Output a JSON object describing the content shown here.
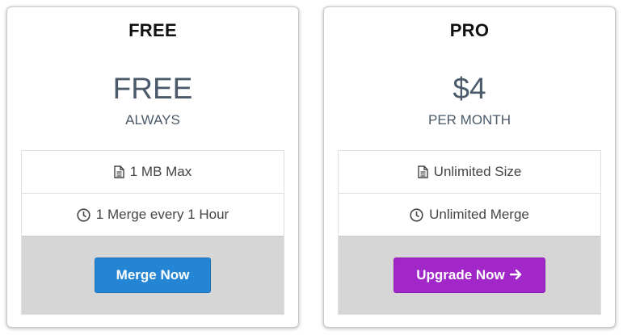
{
  "plans": [
    {
      "name": "FREE",
      "price": "FREE",
      "period": "ALWAYS",
      "features": [
        {
          "icon": "document-icon",
          "text": "1 MB Max"
        },
        {
          "icon": "clock-icon",
          "text": "1 Merge every 1 Hour"
        }
      ],
      "button": {
        "label": "Merge Now",
        "color": "#2485d5"
      }
    },
    {
      "name": "PRO",
      "price": "$4",
      "period": "PER MONTH",
      "features": [
        {
          "icon": "document-icon",
          "text": "Unlimited Size"
        },
        {
          "icon": "clock-icon",
          "text": "Unlimited Merge"
        }
      ],
      "button": {
        "label": "Upgrade Now",
        "icon": "arrow-right-icon",
        "color": "#a127c8"
      }
    }
  ]
}
